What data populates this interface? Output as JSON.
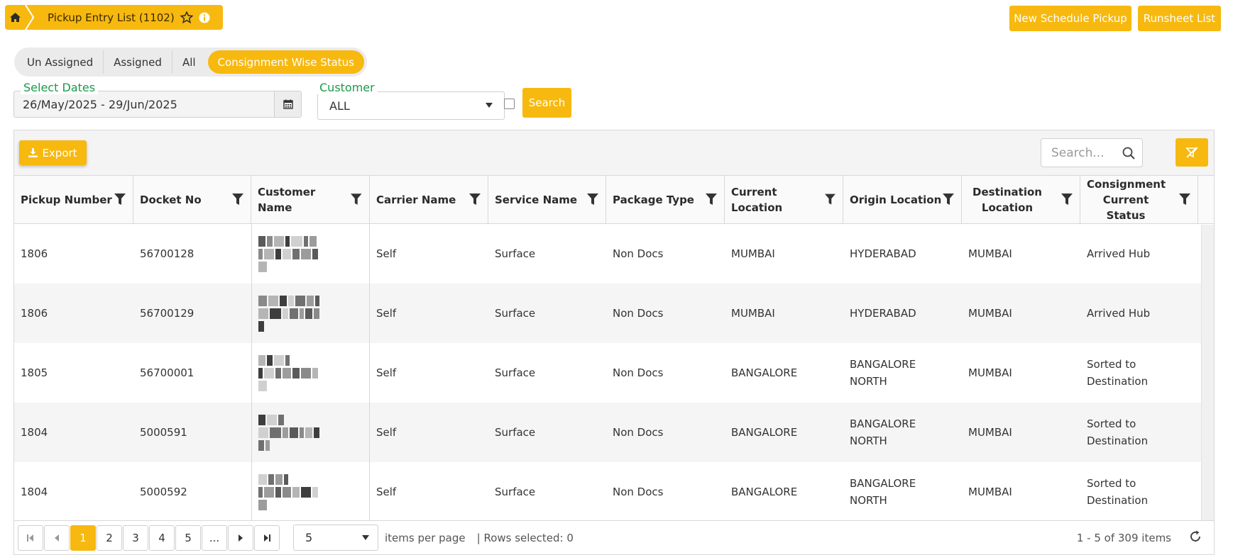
{
  "breadcrumb": {
    "title": "Pickup Entry List (1102)"
  },
  "actions": {
    "new_schedule": "New Schedule Pickup",
    "runsheet": "Runsheet List"
  },
  "tabs": [
    {
      "label": "Un Assigned"
    },
    {
      "label": "Assigned"
    },
    {
      "label": "All"
    },
    {
      "label": "Consignment Wise Status",
      "active": true
    }
  ],
  "filters": {
    "dates_label": "Select Dates",
    "dates_value": "26/May/2025 - 29/Jun/2025",
    "customer_label": "Customer",
    "customer_value": "ALL",
    "search_button": "Search"
  },
  "grid": {
    "export_label": "Export",
    "search_placeholder": "Search...",
    "columns": [
      "Pickup Number",
      "Docket No",
      "Customer Name",
      "Carrier Name",
      "Service Name",
      "Package Type",
      "Current Location",
      "Origin Location",
      "Destination Location",
      "Consignment Current Status"
    ],
    "rows": [
      {
        "pickup": "1806",
        "docket": "56700128",
        "carrier": "Self",
        "service": "Surface",
        "package": "Non Docs",
        "current": "MUMBAI",
        "origin": "HYDERABAD",
        "destination": "MUMBAI",
        "status": "Arrived Hub"
      },
      {
        "pickup": "1806",
        "docket": "56700129",
        "carrier": "Self",
        "service": "Surface",
        "package": "Non Docs",
        "current": "MUMBAI",
        "origin": "HYDERABAD",
        "destination": "MUMBAI",
        "status": "Arrived Hub"
      },
      {
        "pickup": "1805",
        "docket": "56700001",
        "carrier": "Self",
        "service": "Surface",
        "package": "Non Docs",
        "current": "BANGALORE",
        "origin": "BANGALORE NORTH",
        "destination": "MUMBAI",
        "status": "Sorted to Destination"
      },
      {
        "pickup": "1804",
        "docket": "5000591",
        "carrier": "Self",
        "service": "Surface",
        "package": "Non Docs",
        "current": "BANGALORE",
        "origin": "BANGALORE NORTH",
        "destination": "MUMBAI",
        "status": "Sorted to Destination"
      },
      {
        "pickup": "1804",
        "docket": "5000592",
        "carrier": "Self",
        "service": "Surface",
        "package": "Non Docs",
        "current": "BANGALORE",
        "origin": "BANGALORE NORTH",
        "destination": "MUMBAI",
        "status": "Sorted to Destination"
      }
    ]
  },
  "pager": {
    "pages": [
      "1",
      "2",
      "3",
      "4",
      "5",
      "..."
    ],
    "current_page": "1",
    "per_page": "5",
    "items_per_page_label": "items per page",
    "rows_selected": "| Rows selected: 0",
    "info": "1 - 5 of 309 items"
  },
  "colors": {
    "accent": "#f7b90f",
    "label_green": "#1a9a4a"
  }
}
